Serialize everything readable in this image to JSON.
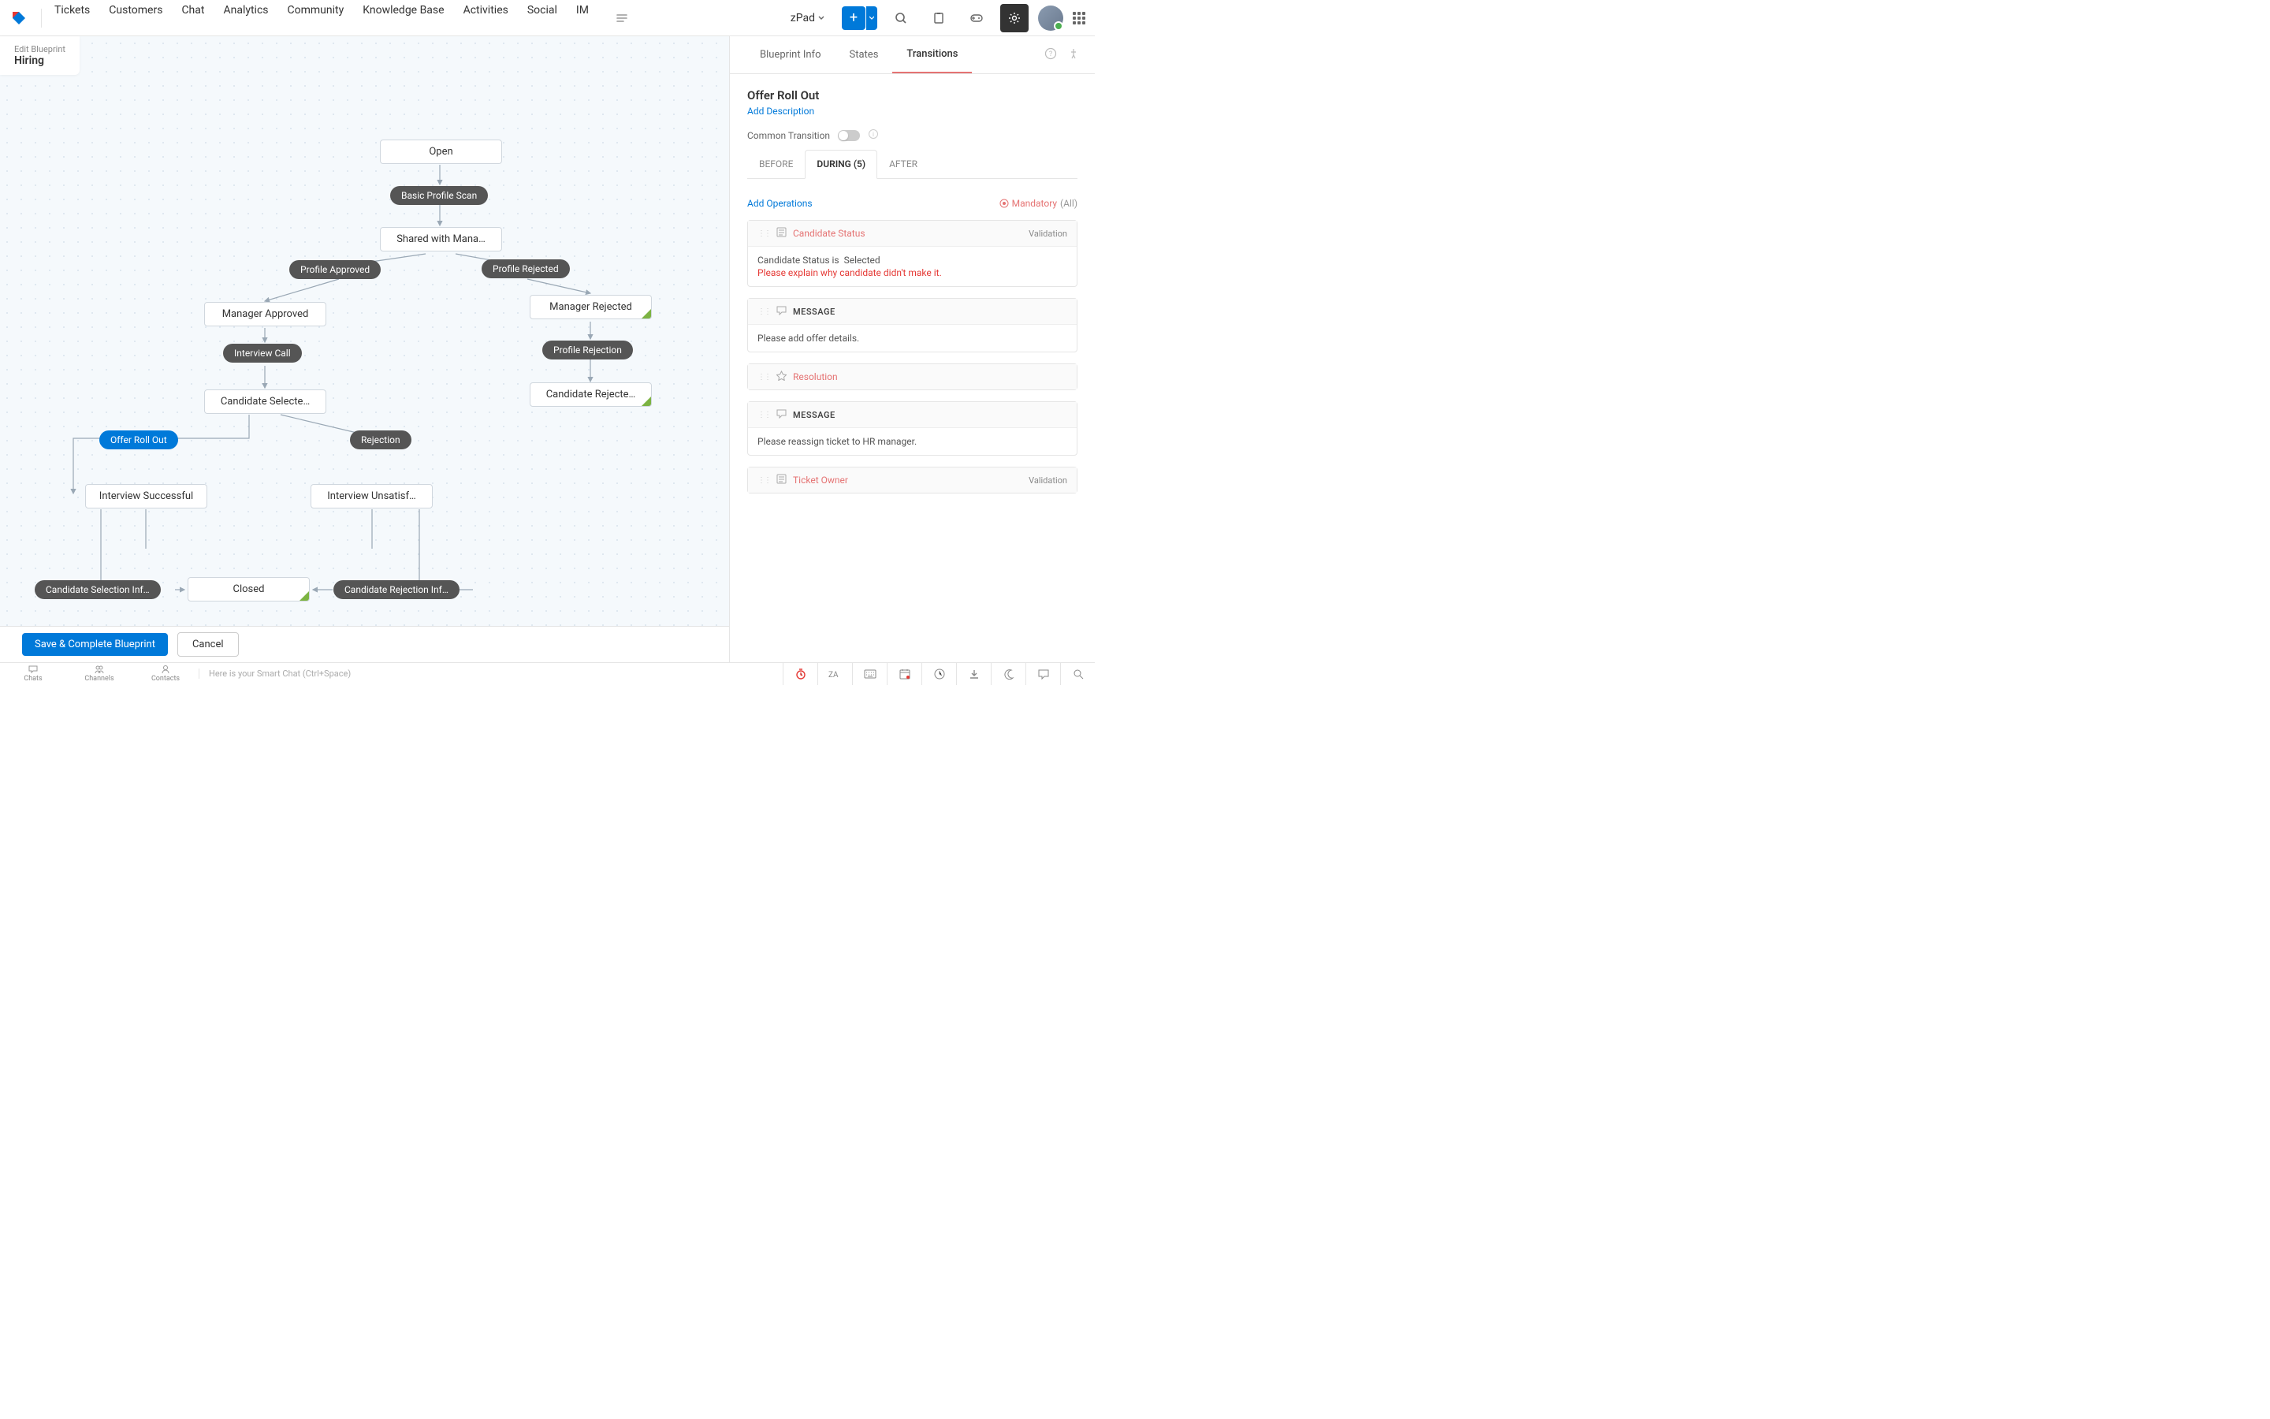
{
  "topnav": {
    "items": [
      "Tickets",
      "Customers",
      "Chat",
      "Analytics",
      "Community",
      "Knowledge Base",
      "Activities",
      "Social",
      "IM"
    ],
    "workspace": "zPad"
  },
  "canvas": {
    "header_small": "Edit Blueprint",
    "header_title": "Hiring",
    "nodes": {
      "open": "Open",
      "basic_scan": "Basic Profile Scan",
      "shared_manager": "Shared with Mana…",
      "profile_approved": "Profile Approved",
      "profile_rejected": "Profile Rejected",
      "manager_approved": "Manager Approved",
      "manager_rejected": "Manager Rejected",
      "interview_call": "Interview Call",
      "profile_rejection": "Profile Rejection",
      "candidate_selected": "Candidate Selecte…",
      "candidate_rejected": "Candidate Rejecte…",
      "offer_roll_out": "Offer Roll Out",
      "rejection": "Rejection",
      "interview_successful": "Interview Successful",
      "interview_unsatisfactory": "Interview Unsatisf…",
      "candidate_sel_info": "Candidate Selection Inf…",
      "closed": "Closed",
      "candidate_rej_info": "Candidate Rejection Inf…"
    },
    "save_btn": "Save & Complete Blueprint",
    "cancel_btn": "Cancel"
  },
  "panel": {
    "tabs": {
      "info": "Blueprint Info",
      "states": "States",
      "transitions": "Transitions"
    },
    "title": "Offer Roll Out",
    "add_desc": "Add Description",
    "common_transition": "Common Transition",
    "phase": {
      "before": "BEFORE",
      "during": "DURING (5)",
      "after": "AFTER"
    },
    "add_ops": "Add Operations",
    "mandatory": "Mandatory",
    "all": "(All)",
    "ops": [
      {
        "type": "field",
        "name": "Candidate Status",
        "tag": "Validation",
        "body_line1": "Candidate Status is",
        "body_value": "Selected",
        "body_error": "Please explain why candidate didn't make it."
      },
      {
        "type": "message",
        "name": "MESSAGE",
        "body": "Please add offer details."
      },
      {
        "type": "resolution",
        "name": "Resolution"
      },
      {
        "type": "message",
        "name": "MESSAGE",
        "body": "Please reassign ticket to HR manager."
      },
      {
        "type": "field",
        "name": "Ticket Owner",
        "tag": "Validation"
      }
    ]
  },
  "bottombar": {
    "tabs": [
      "Chats",
      "Channels",
      "Contacts"
    ],
    "placeholder": "Here is your Smart Chat (Ctrl+Space)"
  }
}
